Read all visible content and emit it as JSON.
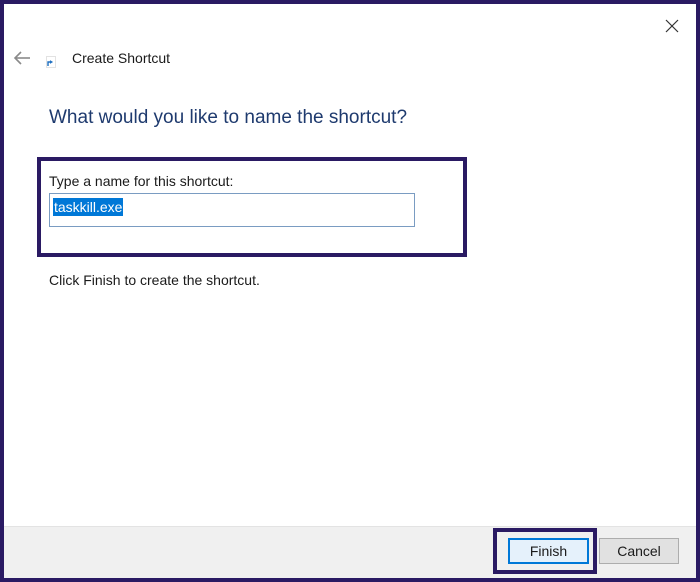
{
  "wizard": {
    "title": "Create Shortcut"
  },
  "main": {
    "heading": "What would you like to name the shortcut?",
    "field_label": "Type a name for this shortcut:",
    "name_value": "taskkill.exe",
    "hint": "Click Finish to create the shortcut."
  },
  "footer": {
    "finish_label": "Finish",
    "cancel_label": "Cancel"
  },
  "colors": {
    "accent": "#0078d7",
    "heading": "#1e3a6e",
    "highlight_border": "#2a1a63"
  },
  "icons": {
    "close": "close-icon",
    "back": "back-arrow-icon",
    "wizard": "shortcut-icon"
  }
}
